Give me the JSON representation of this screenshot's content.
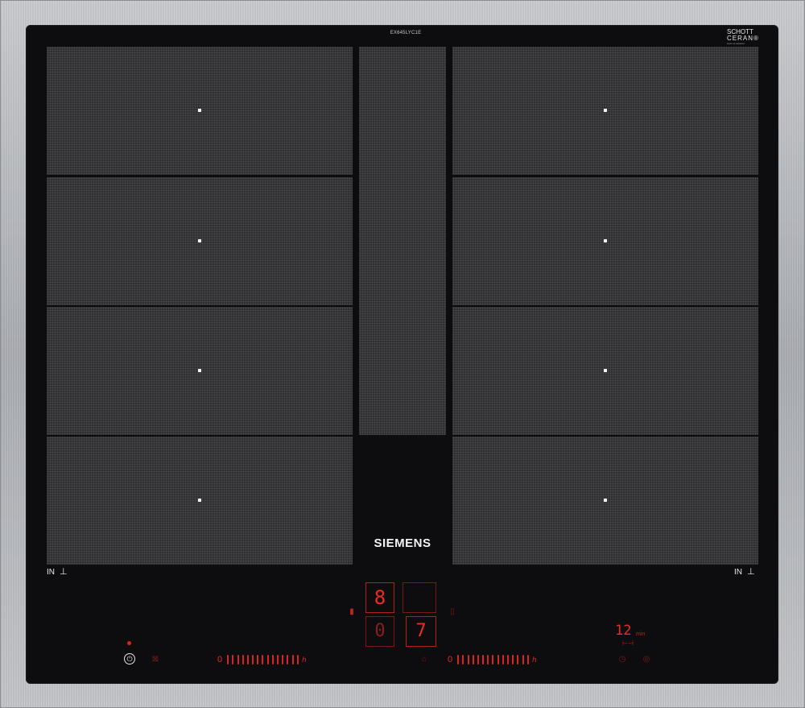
{
  "cooktop": {
    "model": "EX645LYC1E",
    "glass_logo": {
      "line1": "SCHOTT",
      "line2": "CERAN",
      "mark": "®",
      "line3": "ᴍᴀᴅᴇ ɪɴ ɢᴇʀᴍᴀɴʏ"
    },
    "brand": "SIEMENS",
    "zone_labels": {
      "left": "IN",
      "right": "IN"
    }
  },
  "controls": {
    "power_symbol": "⏻",
    "slider_min": "0",
    "left_display": {
      "top_digit": "8",
      "bottom_digit": "0"
    },
    "right_display": {
      "top_digit": "",
      "bottom_digit": "7"
    },
    "timer": {
      "digits": "12",
      "unit": "min",
      "sub_symbol": "⊢⊣"
    },
    "slider_levels": 15,
    "colors": {
      "glass": "#0d0d0f",
      "zone": "#2e2e31",
      "frame": "#b5b7bb",
      "display_red": "#ef2a22"
    },
    "icons": [
      "power-icon",
      "child-lock-icon",
      "power-boost-icon",
      "wipe-protection-icon",
      "frying-sensor-icon",
      "timer-icon",
      "favorite-icon",
      "induction-pan-icon"
    ]
  }
}
